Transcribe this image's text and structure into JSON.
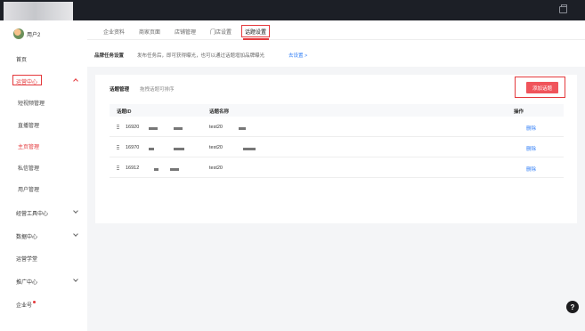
{
  "user": {
    "name": "用户2"
  },
  "sidebar": {
    "items": [
      {
        "label": "首页"
      },
      {
        "label": "运营中心"
      },
      {
        "label": "短视频管理"
      },
      {
        "label": "直播管理"
      },
      {
        "label": "主页管理"
      },
      {
        "label": "私信管理"
      },
      {
        "label": "用户管理"
      },
      {
        "label": "经营工具中心"
      },
      {
        "label": "数据中心"
      },
      {
        "label": "运营学堂"
      },
      {
        "label": "推广中心"
      },
      {
        "label": "企业号"
      }
    ]
  },
  "tabs": [
    {
      "label": "企业资料"
    },
    {
      "label": "商家页面"
    },
    {
      "label": "店铺管理"
    },
    {
      "label": "门店设置"
    },
    {
      "label": "话题设置"
    }
  ],
  "info_bar": {
    "label": "品牌任务设置",
    "desc": "发布任务后，即可获得曝光，也可以通过话题增加品牌曝光",
    "link": "去设置 >"
  },
  "panel": {
    "title": "话题管理",
    "subtitle": "拖拽话题可排序",
    "add_button": "添加话题",
    "headers": {
      "id": "话题ID",
      "name": "话题名称",
      "op": "操作"
    },
    "rows": [
      {
        "id": "16920",
        "name": "test20",
        "op": "删除"
      },
      {
        "id": "16970",
        "name": "test20",
        "op": "删除"
      },
      {
        "id": "16912",
        "name": "test20",
        "op": "删除"
      }
    ]
  },
  "help": {
    "label": "?"
  },
  "colors": {
    "accent": "#e4393c",
    "link": "#2f7df6",
    "button": "#f0545b"
  }
}
